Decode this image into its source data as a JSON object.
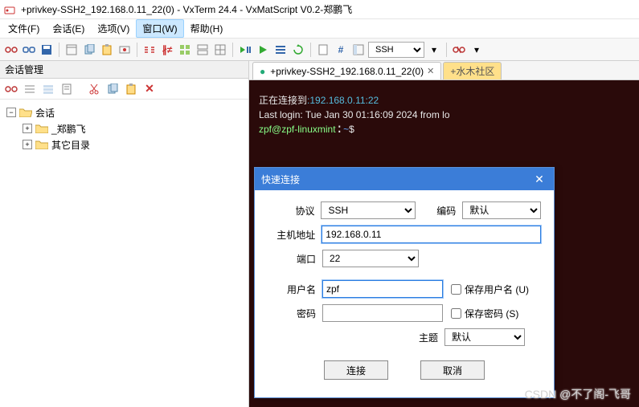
{
  "titlebar": {
    "title": "+privkey-SSH2_192.168.0.11_22(0) - VxTerm 24.4 - VxMatScript V0.2-郑鹏飞"
  },
  "menubar": {
    "file": "文件(F)",
    "session": "会话(E)",
    "options": "选项(V)",
    "window": "窗口(W)",
    "help": "帮助(H)"
  },
  "toolbar": {
    "proto_select": "SSH"
  },
  "sidebar": {
    "header": "会话管理",
    "root": "会话",
    "nodes": [
      "_郑鹏飞",
      "其它目录"
    ]
  },
  "tabs": {
    "active": "+privkey-SSH2_192.168.0.11_22(0)",
    "link": "+水木社区"
  },
  "terminal": {
    "line1a": "正在连接到",
    "line1b": ":192.168.0.11:22",
    "line2": "Last login: Tue Jan 30 01:16:09 2024 from lo",
    "prompt_user": "zpf@zpf-linuxmint",
    "prompt_path": "~",
    "prompt_symbol": "$"
  },
  "dialog": {
    "title": "快速连接",
    "labels": {
      "protocol": "协议",
      "encoding": "编码",
      "host": "主机地址",
      "port": "端口",
      "user": "用户名",
      "pass": "密码",
      "theme": "主题",
      "save_user": "保存用户名 (U)",
      "save_pass": "保存密码 (S)"
    },
    "values": {
      "protocol": "SSH",
      "encoding": "默认",
      "host": "192.168.0.11",
      "port": "22",
      "user": "zpf",
      "pass": "",
      "theme": "默认"
    },
    "buttons": {
      "connect": "连接",
      "cancel": "取消"
    }
  },
  "watermark": "CSDN @不了阁-飞哥"
}
